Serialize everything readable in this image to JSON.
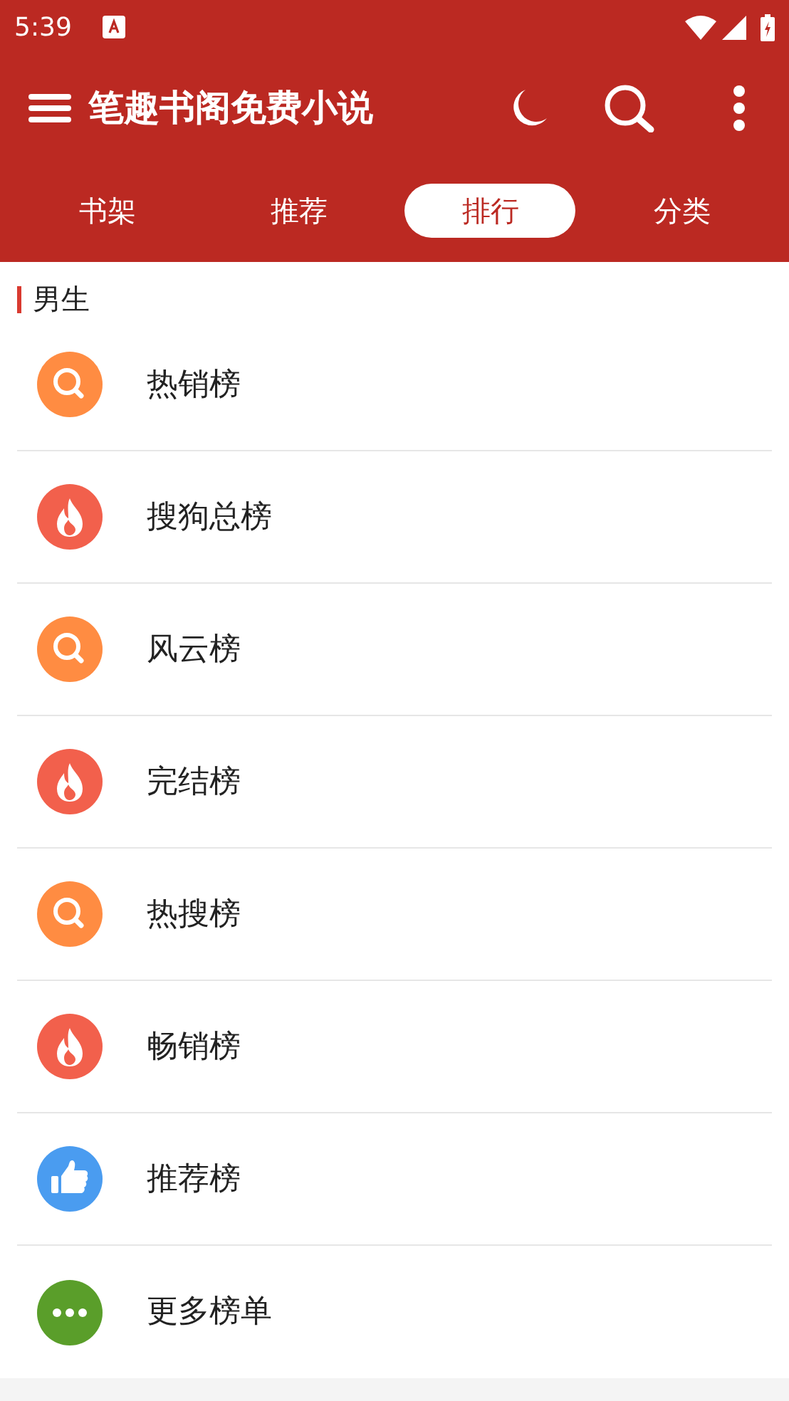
{
  "status_bar": {
    "time": "5:39"
  },
  "app_bar": {
    "title": "笔趣书阁免费小说"
  },
  "tabs": [
    {
      "label": "书架",
      "selected": false
    },
    {
      "label": "推荐",
      "selected": false
    },
    {
      "label": "排行",
      "selected": true
    },
    {
      "label": "分类",
      "selected": false
    }
  ],
  "section": {
    "title": "男生"
  },
  "items": [
    {
      "label": "热销榜",
      "kind": "search"
    },
    {
      "label": "搜狗总榜",
      "kind": "fire"
    },
    {
      "label": "风云榜",
      "kind": "search"
    },
    {
      "label": "完结榜",
      "kind": "fire"
    },
    {
      "label": "热搜榜",
      "kind": "search"
    },
    {
      "label": "畅销榜",
      "kind": "fire"
    },
    {
      "label": "推荐榜",
      "kind": "thumb"
    },
    {
      "label": "更多榜单",
      "kind": "more"
    }
  ]
}
